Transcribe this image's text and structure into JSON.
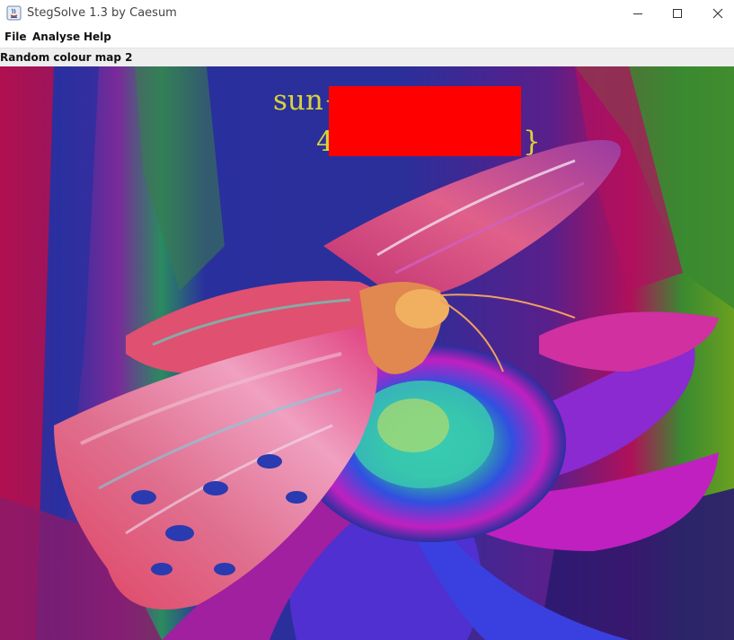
{
  "window": {
    "title": "StegSolve 1.3 by Caesum",
    "controls": {
      "minimize": "minimize-icon",
      "maximize": "maximize-icon",
      "close": "close-icon"
    }
  },
  "menu": {
    "items": [
      "File",
      "Analyse",
      "Help"
    ]
  },
  "view": {
    "plane_label": "Random colour map 2",
    "flag_line1_prefix": "sun{",
    "flag_line2_prefix": "4",
    "flag_line2_suffix": "}",
    "redaction_color": "#ff0000",
    "text_color": "#d8d23c"
  }
}
